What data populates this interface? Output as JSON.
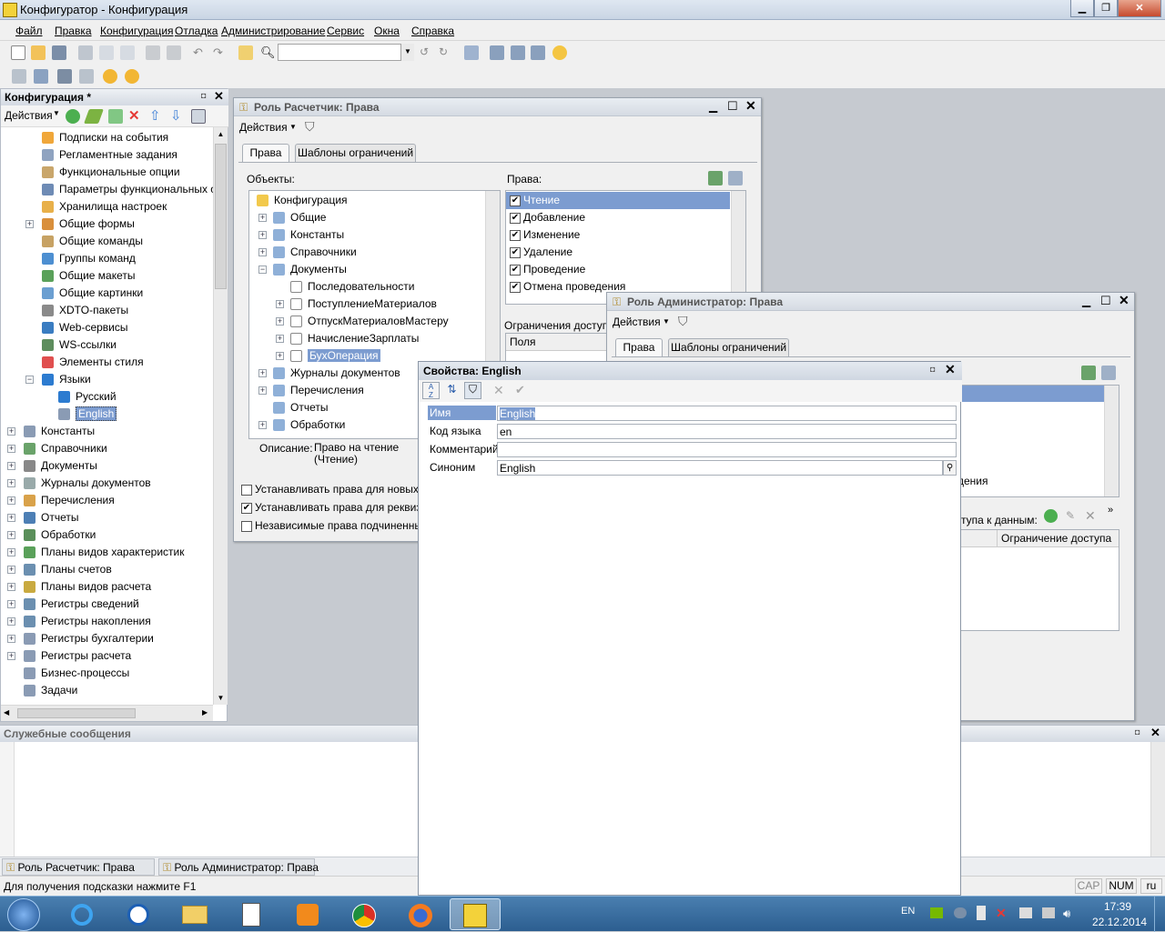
{
  "window": {
    "title": "Конфигуратор - Конфигурация"
  },
  "menu": [
    "Файл",
    "Правка",
    "Конфигурация",
    "Отладка",
    "Администрирование",
    "Сервис",
    "Окна",
    "Справка"
  ],
  "config_panel": {
    "title": "Конфигурация *",
    "actions_label": "Действия",
    "items": [
      {
        "label": "Подписки на события",
        "level": 2
      },
      {
        "label": "Регламентные задания",
        "level": 2
      },
      {
        "label": "Функциональные опции",
        "level": 2
      },
      {
        "label": "Параметры функциональных опц",
        "level": 2
      },
      {
        "label": "Хранилища настроек",
        "level": 2
      },
      {
        "label": "Общие формы",
        "level": 2,
        "expandable": true
      },
      {
        "label": "Общие команды",
        "level": 2
      },
      {
        "label": "Группы команд",
        "level": 2
      },
      {
        "label": "Общие макеты",
        "level": 2
      },
      {
        "label": "Общие картинки",
        "level": 2
      },
      {
        "label": "XDTO-пакеты",
        "level": 2
      },
      {
        "label": "Web-сервисы",
        "level": 2
      },
      {
        "label": "WS-ссылки",
        "level": 2
      },
      {
        "label": "Элементы стиля",
        "level": 2
      },
      {
        "label": "Языки",
        "level": 2,
        "expanded": true
      },
      {
        "label": "Русский",
        "level": 3
      },
      {
        "label": "English",
        "level": 3,
        "selected": true
      },
      {
        "label": "Константы",
        "level": 1,
        "expandable": true
      },
      {
        "label": "Справочники",
        "level": 1,
        "expandable": true
      },
      {
        "label": "Документы",
        "level": 1,
        "expandable": true
      },
      {
        "label": "Журналы документов",
        "level": 1,
        "expandable": true
      },
      {
        "label": "Перечисления",
        "level": 1,
        "expandable": true
      },
      {
        "label": "Отчеты",
        "level": 1,
        "expandable": true
      },
      {
        "label": "Обработки",
        "level": 1,
        "expandable": true
      },
      {
        "label": "Планы видов характеристик",
        "level": 1,
        "expandable": true
      },
      {
        "label": "Планы счетов",
        "level": 1,
        "expandable": true
      },
      {
        "label": "Планы видов расчета",
        "level": 1,
        "expandable": true
      },
      {
        "label": "Регистры сведений",
        "level": 1,
        "expandable": true
      },
      {
        "label": "Регистры накопления",
        "level": 1,
        "expandable": true
      },
      {
        "label": "Регистры бухгалтерии",
        "level": 1,
        "expandable": true
      },
      {
        "label": "Регистры расчета",
        "level": 1,
        "expandable": true
      },
      {
        "label": "Бизнес-процессы",
        "level": 1
      },
      {
        "label": "Задачи",
        "level": 1
      }
    ]
  },
  "role_accountant": {
    "title": "Роль Расчетчик: Права",
    "actions_label": "Действия",
    "tabs": [
      "Права",
      "Шаблоны ограничений"
    ],
    "objects_label": "Объекты:",
    "rights_label": "Права:",
    "objects": [
      {
        "label": "Конфигурация",
        "level": 0
      },
      {
        "label": "Общие",
        "level": 1
      },
      {
        "label": "Константы",
        "level": 1
      },
      {
        "label": "Справочники",
        "level": 1
      },
      {
        "label": "Документы",
        "level": 1
      },
      {
        "label": "Последовательности",
        "level": 2
      },
      {
        "label": "ПоступлениеМатериалов",
        "level": 2
      },
      {
        "label": "ОтпускМатериаловМастеру",
        "level": 2
      },
      {
        "label": "НачислениеЗарплаты",
        "level": 2
      },
      {
        "label": "БухОперация",
        "level": 2,
        "selected": true
      },
      {
        "label": "Журналы документов",
        "level": 1
      },
      {
        "label": "Перечисления",
        "level": 1
      },
      {
        "label": "Отчеты",
        "level": 1
      },
      {
        "label": "Обработки",
        "level": 1
      }
    ],
    "rights": [
      "Чтение",
      "Добавление",
      "Изменение",
      "Удаление",
      "Проведение",
      "Отмена проведения"
    ],
    "restrictions_label": "Ограничения доступа",
    "fields_header": "Поля",
    "description_label": "Описание:",
    "description_text": "Право на чтение (Чтение)",
    "options": [
      {
        "label": "Устанавливать права для новых об",
        "checked": false
      },
      {
        "label": "Устанавливать права для реквизи",
        "checked": true
      },
      {
        "label": "Независимые права подчиненных",
        "checked": false
      }
    ]
  },
  "role_admin": {
    "title": "Роль Администратор: Права",
    "actions_label": "Действия",
    "tabs": [
      "Права",
      "Шаблоны ограничений"
    ],
    "partial_text_1": "дения",
    "partial_text_2": "тупа к данным:",
    "restriction_header": "Ограничение доступа"
  },
  "properties": {
    "title": "Свойства: English",
    "fields": [
      {
        "label": "Имя",
        "value": "English",
        "selected": true
      },
      {
        "label": "Код языка",
        "value": "en"
      },
      {
        "label": "Комментарий",
        "value": ""
      },
      {
        "label": "Синоним",
        "value": "English"
      }
    ]
  },
  "messages_panel": {
    "title": "Служебные сообщения"
  },
  "window_tabs": [
    "Роль Расчетчик: Права",
    "Роль Администратор: Права"
  ],
  "status": {
    "hint": "Для получения подсказки нажмите F1",
    "cap": "CAP",
    "num": "NUM",
    "lang": "ru"
  },
  "taskbar": {
    "lang": "EN",
    "time": "17:39",
    "date": "22.12.2014"
  }
}
